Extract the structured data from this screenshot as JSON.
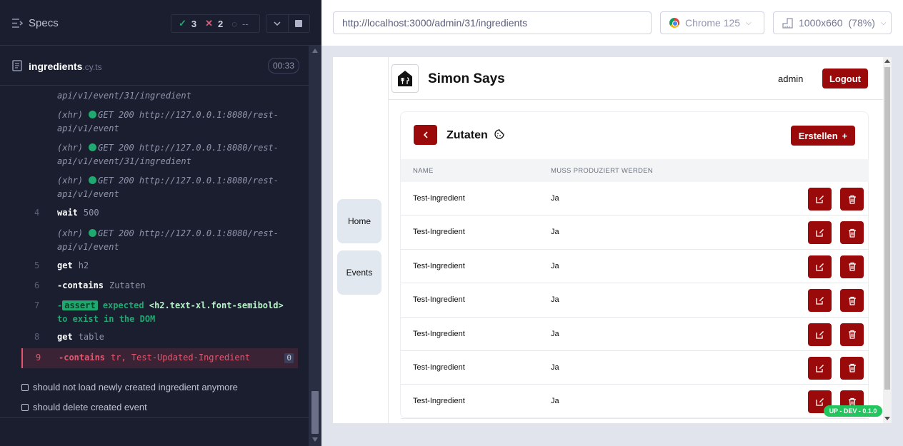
{
  "runner": {
    "specs_label": "Specs",
    "stats": {
      "passed": "3",
      "failed": "2",
      "pending": "--"
    },
    "file": {
      "name": "ingredients",
      "ext": ".cy.ts",
      "time": "00:33"
    },
    "commands": [
      {
        "type": "xhr-partial",
        "url_tail": "api/v1/event/31/ingredient"
      },
      {
        "type": "xhr",
        "tag": "(xhr)",
        "method": "GET 200 http://127.0.0.1:8080/rest-",
        "url_tail": "api/v1/event"
      },
      {
        "type": "xhr",
        "tag": "(xhr)",
        "method": "GET 200 http://127.0.0.1:8080/rest-",
        "url_tail": "api/v1/event/31/ingredient"
      },
      {
        "type": "xhr",
        "tag": "(xhr)",
        "method": "GET 200 http://127.0.0.1:8080/rest-",
        "url_tail": "api/v1/event"
      },
      {
        "type": "cmd",
        "num": "4",
        "name": "wait",
        "arg": "500"
      },
      {
        "type": "xhr",
        "tag": "(xhr)",
        "method": "GET 200 http://127.0.0.1:8080/rest-",
        "url_tail": "api/v1/event"
      },
      {
        "type": "cmd",
        "num": "5",
        "name": "get",
        "arg": "h2"
      },
      {
        "type": "cmd",
        "num": "6",
        "name": "-contains",
        "arg": "Zutaten"
      },
      {
        "type": "assert",
        "num": "7",
        "badge": "assert",
        "text1": "expected",
        "el": "<h2.text-xl.font-semibold>",
        "text2": "to exist in the DOM"
      },
      {
        "type": "cmd",
        "num": "8",
        "name": "get",
        "arg": "table"
      },
      {
        "type": "fail",
        "num": "9",
        "name": "-contains",
        "arg": "tr, Test-Updated-Ingredient",
        "count": "0"
      }
    ],
    "tests": [
      "should not load newly created ingredient anymore",
      "should delete created event"
    ]
  },
  "browser": {
    "url": "http://localhost:3000/admin/31/ingredients",
    "browser_name": "Chrome 125",
    "viewport": "1000x660",
    "zoom": "(78%)"
  },
  "app": {
    "title": "Simon Says",
    "user": "admin",
    "logout_label": "Logout",
    "nav": [
      "Home",
      "Events"
    ],
    "page_title": "Zutaten",
    "create_label": "Erstellen",
    "columns": [
      "NAME",
      "MUSS PRODUZIERT WERDEN"
    ],
    "rows": [
      {
        "name": "Test-Ingredient",
        "produce": "Ja"
      },
      {
        "name": "Test-Ingredient",
        "produce": "Ja"
      },
      {
        "name": "Test-Ingredient",
        "produce": "Ja"
      },
      {
        "name": "Test-Ingredient",
        "produce": "Ja"
      },
      {
        "name": "Test-Ingredient",
        "produce": "Ja"
      },
      {
        "name": "Test-Ingredient",
        "produce": "Ja"
      },
      {
        "name": "Test-Ingredient",
        "produce": "Ja"
      }
    ],
    "env_badge": "UP - DEV - 0.1.0"
  },
  "colors": {
    "brand_red": "#9b0a0a",
    "pass_green": "#1fa971",
    "fail_red": "#e45770",
    "env_green": "#22c55e"
  }
}
